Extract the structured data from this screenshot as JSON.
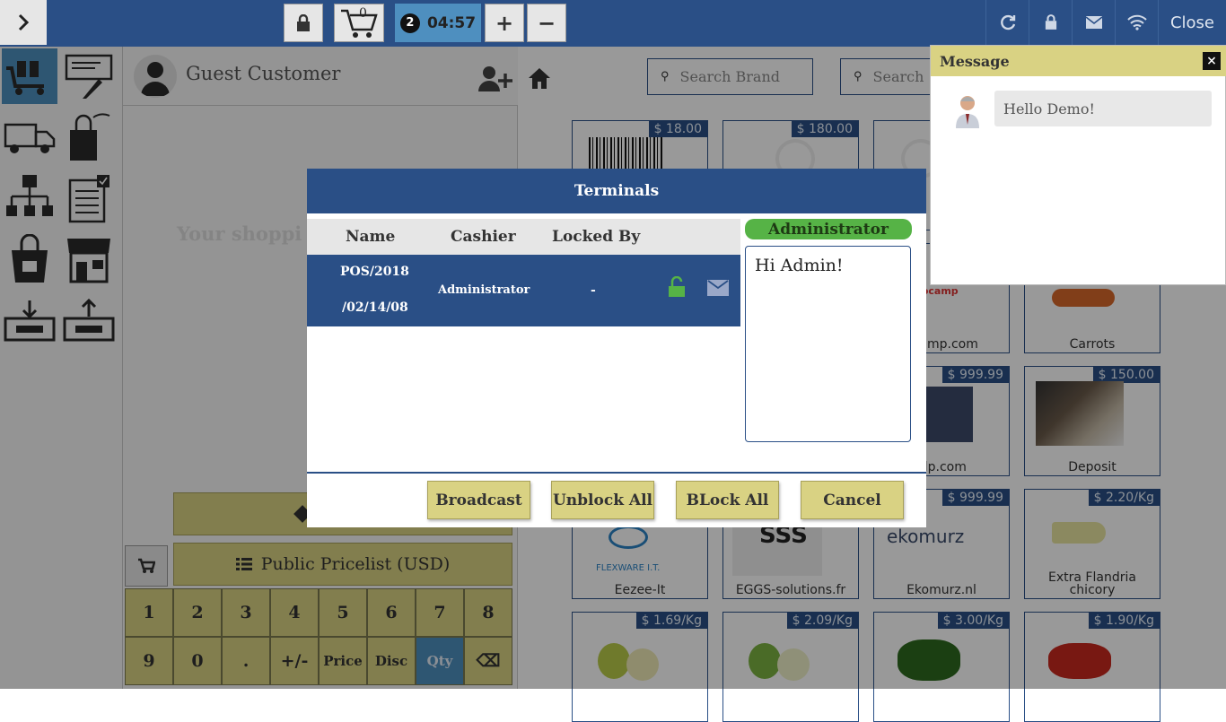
{
  "topbar": {
    "timer_badge": "2",
    "timer": "04:57",
    "cart_count": "0",
    "plus": "+",
    "minus": "−",
    "close_label": "Close"
  },
  "order": {
    "customer_name": "Guest Customer",
    "empty_message": "Your shoppi",
    "pricelist_label": "Public Pricelist (USD)",
    "keys": [
      "1",
      "2",
      "3",
      "4",
      "5",
      "6",
      "7",
      "8",
      "9",
      "0",
      ".",
      "+/-",
      "Price",
      "Disc",
      "Qty",
      "⌫"
    ],
    "selected_key": "Qty"
  },
  "products": {
    "search_brand_placeholder": "Search Brand",
    "search_placeholder": "Search",
    "items": [
      {
        "name": "",
        "price": "$ 18.00"
      },
      {
        "name": "",
        "price": "$ 180.00"
      },
      {
        "name": "",
        "price": ""
      },
      {
        "name": "ocamp.com",
        "price": ""
      },
      {
        "name": "Carrots",
        "price": ""
      },
      {
        "name": "alp.com",
        "price": "$ 999.99"
      },
      {
        "name": "Deposit",
        "price": "$ 150.00"
      },
      {
        "name": "Eezee-It",
        "price": ""
      },
      {
        "name": "EGGS-solutions.fr",
        "price": ""
      },
      {
        "name": "Ekomurz.nl",
        "price": "$ 999.99"
      },
      {
        "name": "Extra Flandria chicory",
        "price": "$ 2.20/Kg"
      },
      {
        "name": "",
        "price": "$ 1.69/Kg"
      },
      {
        "name": "",
        "price": "$ 2.09/Kg"
      },
      {
        "name": "",
        "price": "$ 3.00/Kg"
      },
      {
        "name": "",
        "price": "$ 1.90/Kg"
      }
    ]
  },
  "message_panel": {
    "title": "Message",
    "close": "×",
    "bubble_text": "Hello Demo!"
  },
  "modal": {
    "title": "Terminals",
    "columns": [
      "Name",
      "Cashier",
      "Locked By"
    ],
    "row": {
      "name_line1": "POS/2018",
      "name_line2": "/02/14/08",
      "cashier": "Administrator",
      "locked_by": "-"
    },
    "recipient": "Administrator",
    "message_text": "Hi Admin!",
    "buttons": {
      "broadcast": "Broadcast",
      "unblock_all": "Unblock All",
      "block_all": "BLock All",
      "cancel": "Cancel"
    }
  },
  "colors": {
    "primary": "#2a4f86",
    "accent": "#d9d283",
    "success": "#56b346",
    "highlight": "#4e8fbf"
  }
}
